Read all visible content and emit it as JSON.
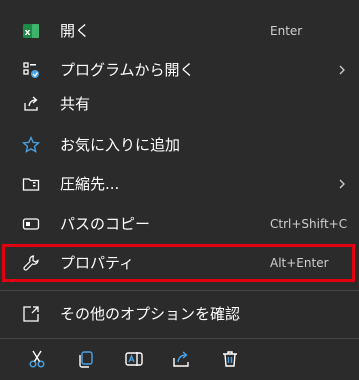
{
  "menu": {
    "items": [
      {
        "label": "開く",
        "shortcut": "Enter",
        "icon": "excel-icon"
      },
      {
        "label": "プログラムから開く",
        "shortcut": "",
        "icon": "open-with-icon",
        "submenu": true
      },
      {
        "label": "共有",
        "shortcut": "",
        "icon": "share-icon"
      },
      {
        "label": "お気に入りに追加",
        "shortcut": "",
        "icon": "star-icon"
      },
      {
        "label": "圧縮先...",
        "shortcut": "",
        "icon": "zip-folder-icon",
        "submenu": true
      },
      {
        "label": "パスのコピー",
        "shortcut": "Ctrl+Shift+C",
        "icon": "copy-path-icon"
      },
      {
        "label": "プロパティ",
        "shortcut": "Alt+Enter",
        "icon": "wrench-icon",
        "highlighted": true
      },
      {
        "label": "その他のオプションを確認",
        "shortcut": "",
        "icon": "more-options-icon"
      }
    ]
  },
  "toolbar": {
    "buttons": [
      "cut-icon",
      "copy-icon",
      "rename-icon",
      "share-icon",
      "delete-icon"
    ]
  },
  "colors": {
    "background": "#2b2b2b",
    "highlight_border": "#e0000f",
    "excel_green": "#1d8b47",
    "accent_blue": "#4aa3e6"
  }
}
